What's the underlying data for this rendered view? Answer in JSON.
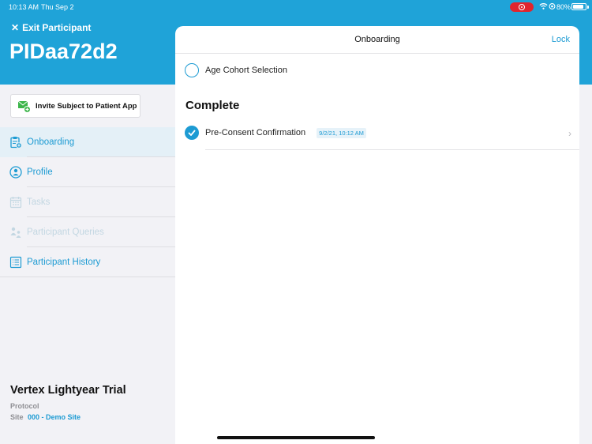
{
  "status_bar": {
    "time": "10:13 AM",
    "date": "Thu Sep 2",
    "battery": "80%"
  },
  "header": {
    "exit_label": "Exit Participant",
    "participant_id": "PIDaa72d2"
  },
  "invite_button": {
    "label": "Invite Subject to Patient App"
  },
  "sidebar": {
    "items": [
      {
        "label": "Onboarding",
        "icon": "clipboard-icon",
        "state": "active"
      },
      {
        "label": "Profile",
        "icon": "person-icon",
        "state": "enabled"
      },
      {
        "label": "Tasks",
        "icon": "calendar-icon",
        "state": "disabled"
      },
      {
        "label": "Participant Queries",
        "icon": "people-icon",
        "state": "disabled"
      },
      {
        "label": "Participant History",
        "icon": "list-icon",
        "state": "enabled"
      }
    ]
  },
  "footer": {
    "trial_name": "Vertex Lightyear Trial",
    "protocol_label": "Protocol",
    "site_label": "Site",
    "site_value": "000 - Demo Site"
  },
  "sheet": {
    "title": "Onboarding",
    "lock_label": "Lock",
    "pending_items": [
      {
        "label": "Age Cohort Selection"
      }
    ],
    "complete_title": "Complete",
    "complete_items": [
      {
        "label": "Pre-Consent Confirmation",
        "timestamp": "9/2/21, 10:12 AM"
      }
    ]
  },
  "colors": {
    "accent": "#1d9bd3",
    "header_band": "#1fa3d8",
    "record_indicator": "#e0252e"
  }
}
